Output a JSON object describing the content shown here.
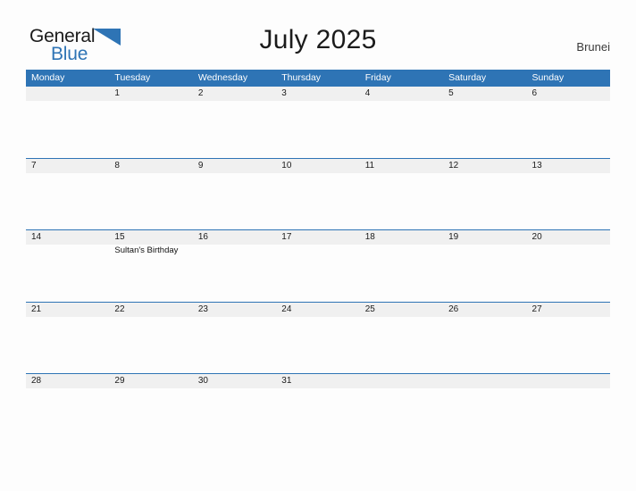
{
  "brand": {
    "word_one": "General",
    "word_two": "Blue",
    "flag_icon": "triangle-flag-icon",
    "color_primary": "#2E74B5",
    "color_text": "#1b1b1b"
  },
  "header": {
    "title": "July 2025",
    "region": "Brunei"
  },
  "calendar": {
    "weekday_headers": [
      "Monday",
      "Tuesday",
      "Wednesday",
      "Thursday",
      "Friday",
      "Saturday",
      "Sunday"
    ],
    "header_bg": "#2E74B5",
    "daystrip_bg": "#f0f0f0",
    "weeks": [
      {
        "days": [
          {
            "num": "",
            "event": ""
          },
          {
            "num": "1",
            "event": ""
          },
          {
            "num": "2",
            "event": ""
          },
          {
            "num": "3",
            "event": ""
          },
          {
            "num": "4",
            "event": ""
          },
          {
            "num": "5",
            "event": ""
          },
          {
            "num": "6",
            "event": ""
          }
        ]
      },
      {
        "days": [
          {
            "num": "7",
            "event": ""
          },
          {
            "num": "8",
            "event": ""
          },
          {
            "num": "9",
            "event": ""
          },
          {
            "num": "10",
            "event": ""
          },
          {
            "num": "11",
            "event": ""
          },
          {
            "num": "12",
            "event": ""
          },
          {
            "num": "13",
            "event": ""
          }
        ]
      },
      {
        "days": [
          {
            "num": "14",
            "event": ""
          },
          {
            "num": "15",
            "event": "Sultan's Birthday"
          },
          {
            "num": "16",
            "event": ""
          },
          {
            "num": "17",
            "event": ""
          },
          {
            "num": "18",
            "event": ""
          },
          {
            "num": "19",
            "event": ""
          },
          {
            "num": "20",
            "event": ""
          }
        ]
      },
      {
        "days": [
          {
            "num": "21",
            "event": ""
          },
          {
            "num": "22",
            "event": ""
          },
          {
            "num": "23",
            "event": ""
          },
          {
            "num": "24",
            "event": ""
          },
          {
            "num": "25",
            "event": ""
          },
          {
            "num": "26",
            "event": ""
          },
          {
            "num": "27",
            "event": ""
          }
        ]
      },
      {
        "days": [
          {
            "num": "28",
            "event": ""
          },
          {
            "num": "29",
            "event": ""
          },
          {
            "num": "30",
            "event": ""
          },
          {
            "num": "31",
            "event": ""
          },
          {
            "num": "",
            "event": ""
          },
          {
            "num": "",
            "event": ""
          },
          {
            "num": "",
            "event": ""
          }
        ]
      }
    ]
  }
}
